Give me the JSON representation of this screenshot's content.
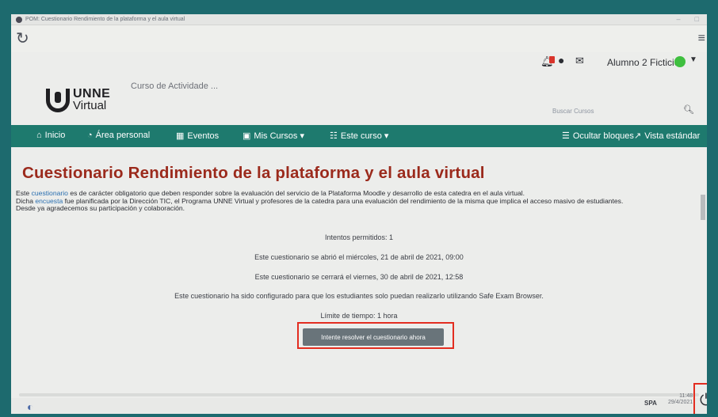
{
  "window": {
    "title": "POM: Cuestionario Rendimiento de la plataforma y el aula virtual"
  },
  "header": {
    "user_name": "Alumno 2 Ficticio",
    "course_name": "Curso de Actividade ...",
    "search_placeholder": "Buscar Cursos",
    "logo_line1": "UNNE",
    "logo_line2": "Virtual"
  },
  "nav": {
    "items": [
      {
        "label": "Inicio",
        "icon": "home-icon"
      },
      {
        "label": "Área personal",
        "icon": "dashboard-icon"
      },
      {
        "label": "Eventos",
        "icon": "calendar-icon"
      },
      {
        "label": "Mis Cursos ▾",
        "icon": "briefcase-icon"
      },
      {
        "label": "Este curso ▾",
        "icon": "people-icon"
      }
    ],
    "hide_blocks": "Ocultar bloques",
    "standard_view": "Vista estándar"
  },
  "quiz": {
    "title": "Cuestionario Rendimiento de la plataforma y el aula virtual",
    "intro_1a": "Este ",
    "intro_1link": "cuestionario",
    "intro_1b": " es de carácter obligatorio que deben responder sobre la evaluación del servicio de la Plataforma Moodle y desarrollo de esta catedra en el aula virtual.",
    "intro_2a": "Dicha ",
    "intro_2link": "encuesta",
    "intro_2b": " fue planificada por la Dirección TIC, el Programa UNNE Virtual y profesores de la catedra para una evaluación del rendimiento de la misma que implica el acceso masivo de estudiantes.",
    "intro_3": "Desde ya agradecemos su participación y colaboración.",
    "attempts": "Intentos permitidos: 1",
    "opened": "Este cuestionario se abrió el miércoles, 21 de abril de 2021, 09:00",
    "closes": "Este cuestionario se cerrará el viernes, 30 de abril de 2021, 12:58",
    "seb_notice": "Este cuestionario ha sido configurado para que los estudiantes solo puedan realizarlo utilizando Safe Exam Browser.",
    "time_limit": "Límite de tiempo: 1 hora",
    "attempt_button": "Intente resolver el cuestionario ahora"
  },
  "taskbar": {
    "language": "SPA",
    "time": "11:48",
    "date": "29/4/2021"
  },
  "colors": {
    "frame": "#1d6a6e",
    "navbar": "#1e7a6e",
    "title": "#9b2a1c",
    "highlight": "#e32d20",
    "button": "#69747a"
  }
}
